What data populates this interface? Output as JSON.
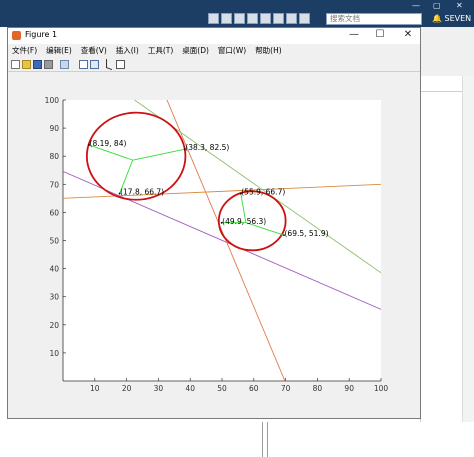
{
  "app": {
    "user": "SEVEN",
    "search_placeholder": "搜索文档",
    "window_controls": [
      "—",
      "▢",
      "✕"
    ]
  },
  "figure_window": {
    "title": "Figure 1",
    "window_controls": [
      "—",
      "☐",
      "✕"
    ],
    "menu": [
      "文件(F)",
      "编辑(E)",
      "查看(V)",
      "插入(I)",
      "工具(T)",
      "桌面(D)",
      "窗口(W)",
      "帮助(H)"
    ],
    "toolbar_icons": [
      "new-figure-icon",
      "open-icon",
      "save-icon",
      "print-icon",
      "print-preview-icon",
      "subplot-icon",
      "layout-icon",
      "pointer-icon",
      "plot-tools-icon"
    ]
  },
  "chart_data": {
    "type": "line",
    "title": "",
    "xlabel": "",
    "ylabel": "",
    "xlim": [
      0,
      100
    ],
    "ylim": [
      0,
      100
    ],
    "xticks": [
      10,
      20,
      30,
      40,
      50,
      60,
      70,
      80,
      90,
      100
    ],
    "yticks": [
      10,
      20,
      30,
      40,
      50,
      60,
      70,
      80,
      90,
      100
    ],
    "grid": false,
    "lines": [
      {
        "color": "#d98a3a",
        "points": [
          [
            0,
            65
          ],
          [
            100,
            70
          ]
        ]
      },
      {
        "color": "#a35ebf",
        "points": [
          [
            0,
            74.6
          ],
          [
            100,
            25.5
          ]
        ]
      },
      {
        "color": "#e07a4a",
        "points": [
          [
            32.7,
            100
          ],
          [
            69.8,
            0
          ]
        ]
      },
      {
        "color": "#8fbf6a",
        "points": [
          [
            22.5,
            100
          ],
          [
            100,
            38.5
          ]
        ]
      }
    ],
    "circles": [
      {
        "cx": 23,
        "cy": 80,
        "r": 15.5,
        "color": "#cc1111"
      },
      {
        "cx": 59.5,
        "cy": 57,
        "r": 10.5,
        "color": "#cc1111"
      }
    ],
    "spokes": [
      {
        "center": [
          21.9,
          78.6
        ],
        "ends": [
          [
            8.19,
            84
          ],
          [
            38.3,
            82.5
          ],
          [
            17.8,
            66.7
          ]
        ]
      },
      {
        "center": [
          57.5,
          56.4
        ],
        "ends": [
          [
            55.9,
            66.7
          ],
          [
            49.9,
            56.3
          ],
          [
            69.5,
            51.9
          ]
        ]
      }
    ],
    "points": [
      {
        "x": 8.19,
        "y": 84,
        "label": "(8.19, 84)"
      },
      {
        "x": 38.3,
        "y": 82.5,
        "label": "(38.3, 82.5)"
      },
      {
        "x": 17.8,
        "y": 66.7,
        "label": "(17.8, 66.7)"
      },
      {
        "x": 55.9,
        "y": 66.7,
        "label": "(55.9, 66.7)"
      },
      {
        "x": 49.9,
        "y": 56.3,
        "label": "(49.9, 56.3)"
      },
      {
        "x": 69.5,
        "y": 51.9,
        "label": "(69.5, 51.9)"
      }
    ]
  }
}
